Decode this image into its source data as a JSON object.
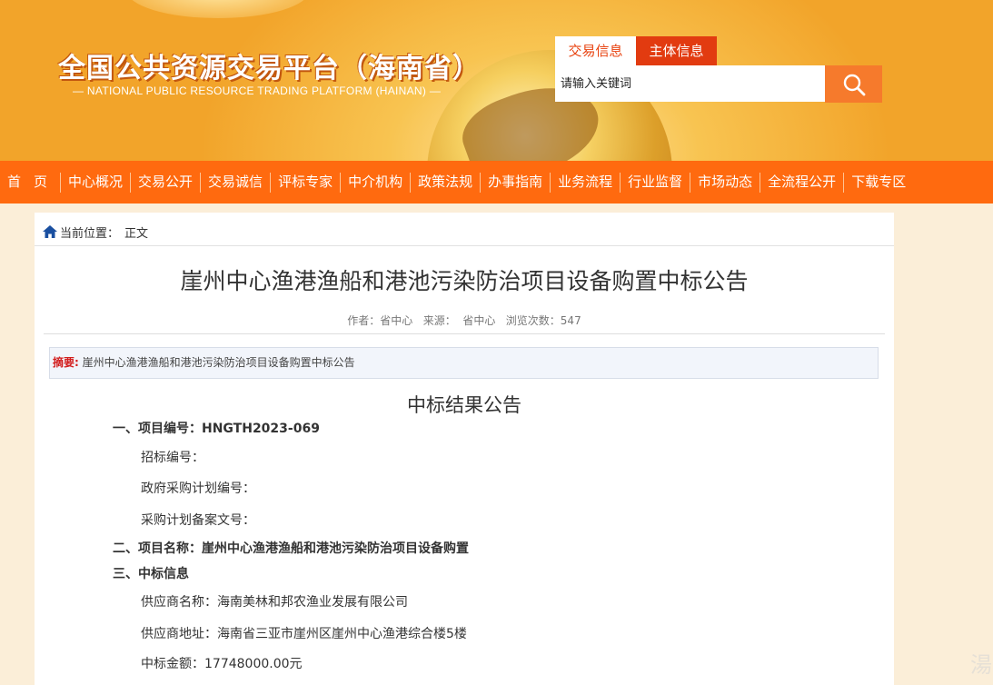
{
  "header": {
    "title": "全国公共资源交易平台（海南省）",
    "subtitle": "— NATIONAL PUBLIC RESOURCE TRADING PLATFORM (HAINAN) —",
    "search_tabs": [
      "交易信息",
      "主体信息"
    ],
    "search_placeholder": "请输入关键词",
    "search_icon": "search-icon"
  },
  "nav": {
    "items": [
      "首页",
      "中心概况",
      "交易公开",
      "交易诚信",
      "评标专家",
      "中介机构",
      "政策法规",
      "办事指南",
      "业务流程",
      "行业监督",
      "市场动态",
      "全流程公开",
      "下载专区"
    ]
  },
  "breadcrumb": {
    "icon": "home-icon",
    "label": "当前位置：",
    "current": "正文"
  },
  "article": {
    "title": "崖州中心渔港渔船和港池污染防治项目设备购置中标公告",
    "meta": "作者：省中心   来源：  省中心   浏览次数：547",
    "summary_label": "摘要:",
    "summary_text": " 崖州中心渔港渔船和港池污染防治项目设备购置中标公告",
    "result_title": "中标结果公告",
    "lines": [
      "一、项目编号：HNGTH2023-069",
      "招标编号：",
      "政府采购计划编号：",
      "采购计划备案文号：",
      "二、项目名称：崖州中心渔港渔船和港池污染防治项目设备购置",
      "三、中标信息",
      "供应商名称：海南美林和邦农渔业发展有限公司",
      "供应商地址：海南省三亚市崖州区崖州中心渔港综合楼5楼",
      "中标金额：17748000.00元"
    ]
  },
  "watermark": "湯"
}
